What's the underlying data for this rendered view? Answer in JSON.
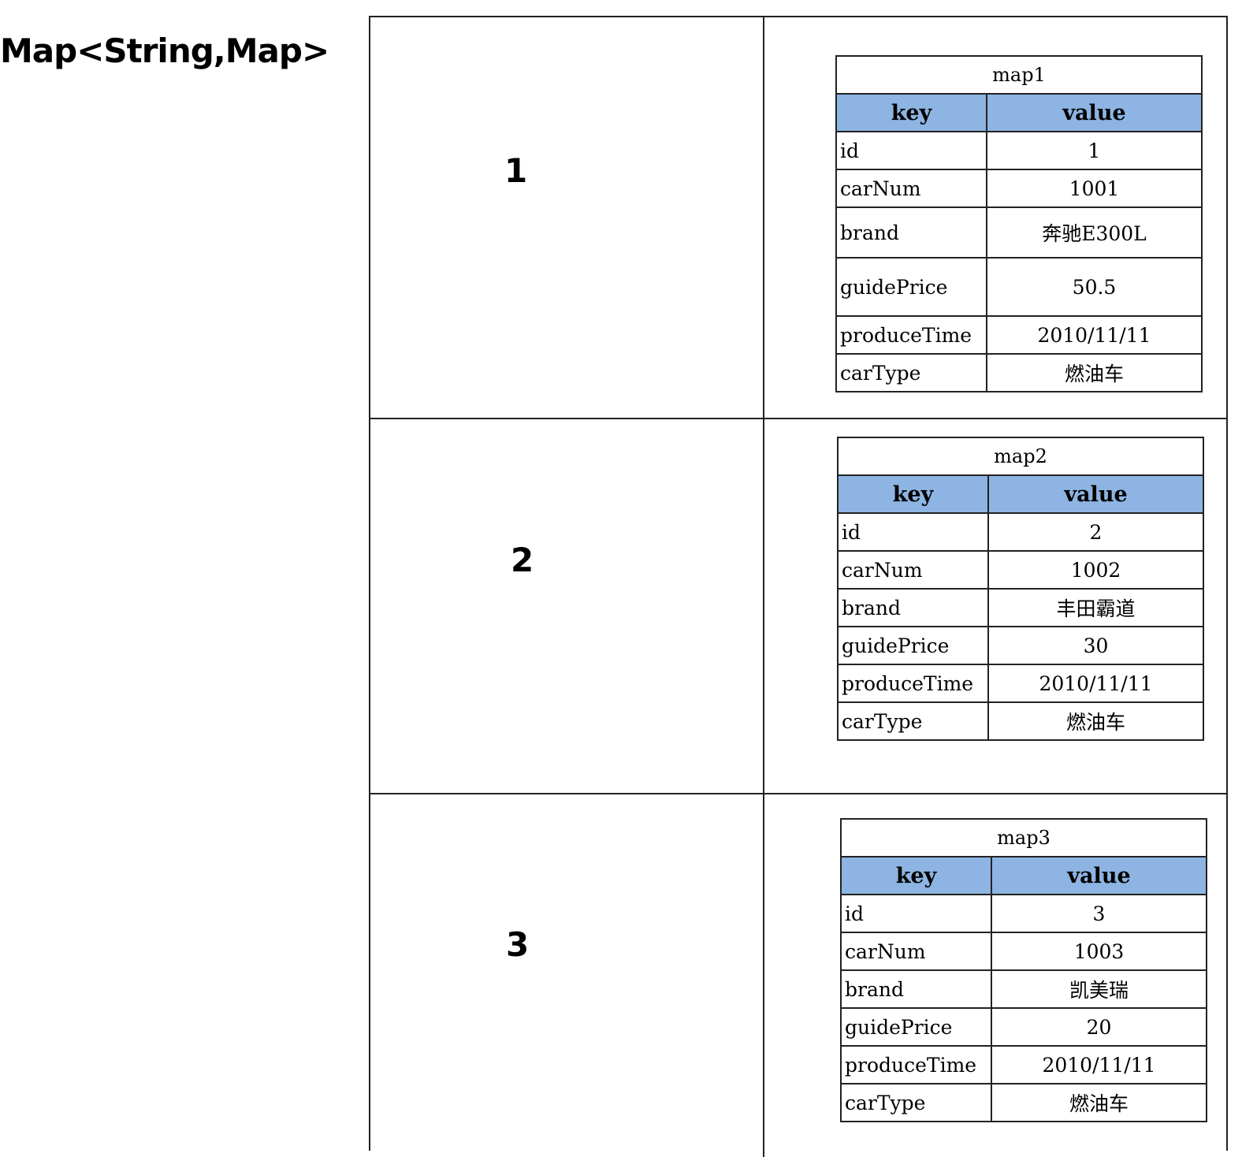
{
  "title": "Map<String,Map>",
  "header": {
    "key": "key",
    "value": "value"
  },
  "entries": [
    {
      "key": "1",
      "map_name": "map1",
      "rows": [
        {
          "k": "id",
          "v": "1"
        },
        {
          "k": "carNum",
          "v": "1001"
        },
        {
          "k": "brand",
          "v": "奔驰E300L"
        },
        {
          "k": "guidePrice",
          "v": "50.5"
        },
        {
          "k": "produceTime",
          "v": "2010/11/11"
        },
        {
          "k": "carType",
          "v": "燃油车"
        }
      ]
    },
    {
      "key": "2",
      "map_name": "map2",
      "rows": [
        {
          "k": "id",
          "v": "2"
        },
        {
          "k": "carNum",
          "v": "1002"
        },
        {
          "k": "brand",
          "v": "丰田霸道"
        },
        {
          "k": "guidePrice",
          "v": "30"
        },
        {
          "k": "produceTime",
          "v": "2010/11/11"
        },
        {
          "k": "carType",
          "v": "燃油车"
        }
      ]
    },
    {
      "key": "3",
      "map_name": "map3",
      "rows": [
        {
          "k": "id",
          "v": "3"
        },
        {
          "k": "carNum",
          "v": "1003"
        },
        {
          "k": "brand",
          "v": "凯美瑞"
        },
        {
          "k": "guidePrice",
          "v": "20"
        },
        {
          "k": "produceTime",
          "v": "2010/11/11"
        },
        {
          "k": "carType",
          "v": "燃油车"
        }
      ]
    }
  ]
}
